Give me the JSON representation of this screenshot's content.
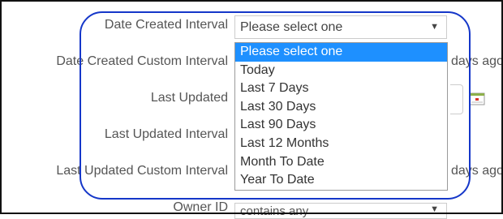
{
  "form": {
    "date_created_interval_label": "Date Created Interval",
    "date_created_custom_interval_label": "Date Created Custom Interval",
    "last_updated_label": "Last Updated",
    "last_updated_interval_label": "Last Updated Interval",
    "last_updated_custom_interval_label": "Last Updated Custom Interval",
    "owner_id_label": "Owner ID",
    "date_created_interval_value": "Please select one",
    "days_ago_1": "days ago",
    "days_ago_2": "days ago",
    "owner_id_value": "contains any"
  },
  "dropdown": {
    "options": [
      "Please select one",
      "Today",
      "Last 7 Days",
      "Last 30 Days",
      "Last 90 Days",
      "Last 12 Months",
      "Month To Date",
      "Year To Date"
    ],
    "selected_index": 0
  },
  "colors": {
    "highlight": "#1537c9",
    "selected_option": "#1e90ff",
    "label_text": "#555555"
  },
  "icons": {
    "calendar": "calendar-icon",
    "dropdown_arrow": "▼"
  }
}
